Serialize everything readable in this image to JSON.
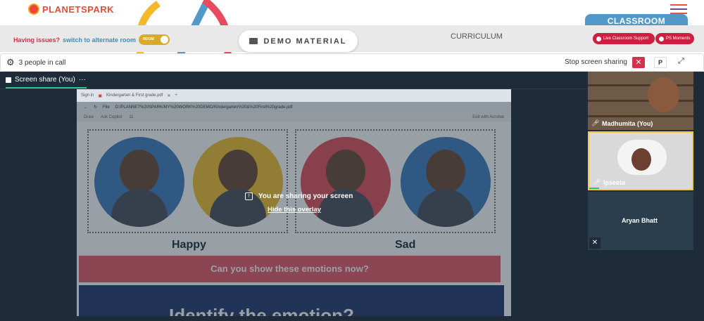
{
  "app": {
    "logo_text": "PLANETSPARK",
    "classroom_tab": "CLASSROOM"
  },
  "header": {
    "issues_text": "Having issues?",
    "alternate_room_text": "switch to alternate room",
    "toggle_label": "ROOM",
    "demo_material_label": "DEMO MATERIAL",
    "curriculum_label": "CURRICULUM",
    "live_support_label": "Live Classroom Support",
    "ps_moments_label": "PS Moments"
  },
  "toolbar": {
    "people_in_call": "3 people in call",
    "stop_sharing_label": "Stop screen sharing",
    "p_button": "P"
  },
  "screen_share": {
    "tab_label": "Screen share (You)",
    "more_menu": "···",
    "overlay_message": "You are sharing your screen",
    "overlay_hide_link": "Hide this overlay"
  },
  "shared_browser": {
    "sign_in": "Sign in",
    "tab_title": "Kindergarten & First grade.pdf",
    "url_prefix": "File",
    "url": "D:/PLANNET%20SPARK/MY%20WORK%20DEMO/Kindergarten%20&%20First%20grade.pdf",
    "draw_label": "Draw",
    "ask_copilot": "Ask Copilot",
    "page_number": "11",
    "edit_with_acrobat": "Edit with Acrobat"
  },
  "slide": {
    "happy_label": "Happy",
    "sad_label": "Sad",
    "question": "Can you show these emotions now?",
    "bottom_partial": "Identify the emotion?"
  },
  "participants": [
    {
      "name": "Madhumita (You)",
      "mic": "on"
    },
    {
      "name": "Ipseeta",
      "mic": "on"
    },
    {
      "name": "Aryan Bhatt",
      "mic": "muted"
    }
  ],
  "colors": {
    "brand_red": "#cf1e40",
    "accent_blue": "#5299c9",
    "stage_bg": "#1d2c38",
    "speaking_border": "#f3c84b",
    "question_band": "#e85a6a"
  }
}
